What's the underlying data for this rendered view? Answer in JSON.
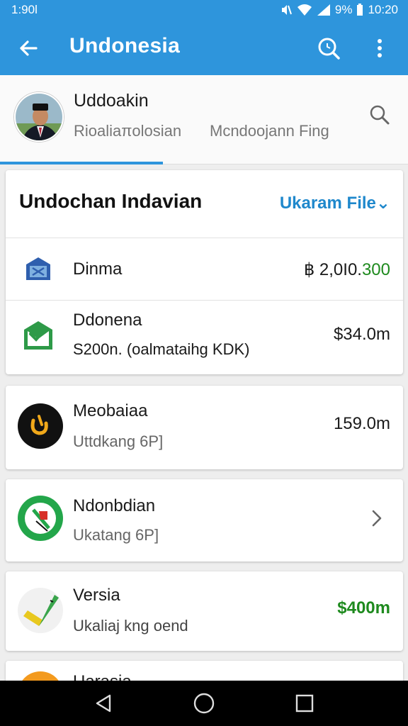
{
  "status_bar": {
    "time": "1:90l",
    "battery_pct": "9%",
    "clock_right": "10:20"
  },
  "app_bar": {
    "title": "Undonesia"
  },
  "profile": {
    "name": "Uddoakin",
    "subtitle_left": "Rioaliaπolosian",
    "subtitle_right": "Mcndoojann Fing"
  },
  "summary_card": {
    "title": "Undochan Indavian",
    "link": "Ukaram File⌄",
    "rows": [
      {
        "title": "Dinma",
        "amount_prefix": "฿ 2,0I0.",
        "amount_suffix": "300"
      },
      {
        "title": "Ddonena",
        "subtitle": "S200n. (oalmataihg KDK)",
        "amount": "$34.0m"
      }
    ]
  },
  "items": [
    {
      "title": "Meobaiaa",
      "subtitle": "Uttdkang 6P]",
      "amount": "159.0m"
    },
    {
      "title": "Ndonbdian",
      "subtitle": "Ukatang 6P]"
    },
    {
      "title": "Versia",
      "subtitle": "Ukaliaj kng oend",
      "amount": "$400m"
    },
    {
      "title": "Uarasia"
    }
  ],
  "colors": {
    "app_bar": "#2e95dc",
    "link": "#1f88cc",
    "positive": "#1e8a1e"
  },
  "icons": [
    "back-arrow-icon",
    "search-icon",
    "more-vert-icon",
    "house-card-icon",
    "envelope-check-icon",
    "circle-ring-icon",
    "flag-no-icon",
    "pencil-icon",
    "chevron-right-icon",
    "nav-back-icon",
    "nav-home-icon",
    "nav-recents-icon"
  ]
}
